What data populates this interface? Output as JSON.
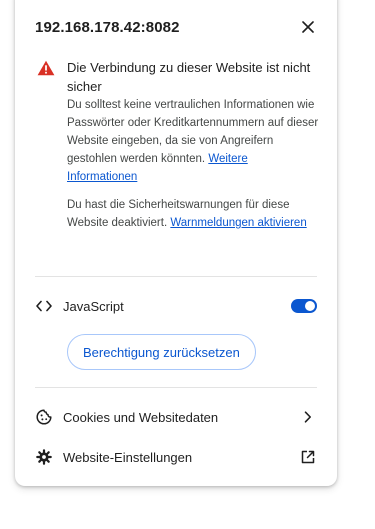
{
  "header": {
    "host": "192.168.178.42:8082",
    "close_icon": "close-icon"
  },
  "warning": {
    "icon": "warning-triangle-icon",
    "icon_color": "#d93025",
    "title": "Die Verbindung zu dieser Website ist nicht sicher",
    "text": "Du solltest keine vertraulichen Informationen wie Passwörter oder Kreditkartennummern auf dieser Website eingeben, da sie von Angreifern gestohlen werden könnten.",
    "more_info_link": "Weitere Informationen",
    "disabled_text": "Du hast die Sicherheitswarnungen für diese Website deaktiviert.",
    "enable_warnings_link": "Warnmeldungen aktivieren"
  },
  "javascript": {
    "icon": "code-icon",
    "label": "JavaScript",
    "enabled": true,
    "toggle_color": "#0b57d0"
  },
  "reset_button": "Berechtigung zurücksetzen",
  "menu": [
    {
      "icon": "cookie-icon",
      "label": "Cookies und Websitedaten",
      "trailing_icon": "chevron-right-icon"
    },
    {
      "icon": "gear-icon",
      "label": "Website-Einstellungen",
      "trailing_icon": "external-link-icon"
    }
  ],
  "colors": {
    "link": "#0b57d0",
    "text": "#1f1f1f",
    "secondary_text": "#444746"
  }
}
